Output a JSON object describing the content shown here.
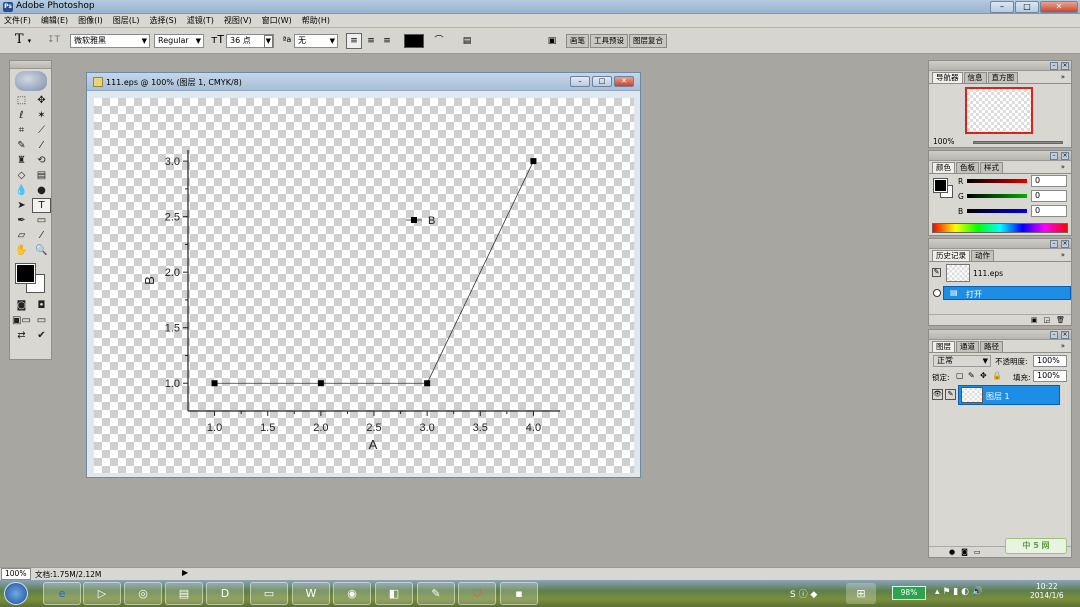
{
  "app": {
    "title": "Adobe Photoshop"
  },
  "menu": [
    "文件(F)",
    "编辑(E)",
    "图像(I)",
    "图层(L)",
    "选择(S)",
    "滤镜(T)",
    "视图(V)",
    "窗口(W)",
    "帮助(H)"
  ],
  "options": {
    "tool_glyph": "T",
    "font_family": "微软雅黑",
    "font_style": "Regular",
    "font_size": "36 点",
    "aa_label": "ªa",
    "aa_value": "无",
    "palette_well": [
      "画笔",
      "工具预设",
      "图层复合"
    ]
  },
  "document": {
    "title": "111.eps @ 100% (图层 1, CMYK/8)"
  },
  "chart_data": {
    "type": "line",
    "xlabel": "A",
    "ylabel": "B",
    "xlim": [
      0.75,
      4.25
    ],
    "ylim": [
      0.75,
      3.1
    ],
    "xticks": [
      "1.0",
      "1.5",
      "2.0",
      "2.5",
      "3.0",
      "3.5",
      "4.0"
    ],
    "yticks": [
      "1.0",
      "1.5",
      "2.0",
      "2.5",
      "3.0"
    ],
    "series": [
      {
        "name": "B",
        "x": [
          1.0,
          2.0,
          3.0,
          4.0
        ],
        "y": [
          1.0,
          1.0,
          1.0,
          3.0
        ]
      }
    ],
    "legend": "top-right",
    "grid": false
  },
  "navigator": {
    "tabs": [
      "导航器",
      "信息",
      "直方图"
    ],
    "zoom": "100%"
  },
  "color_panel": {
    "tabs": [
      "颜色",
      "色板",
      "样式"
    ],
    "channels": [
      {
        "label": "R",
        "value": "0",
        "color": "#d00000"
      },
      {
        "label": "G",
        "value": "0",
        "color": "#00a000"
      },
      {
        "label": "B",
        "value": "0",
        "color": "#0000c8"
      }
    ]
  },
  "history": {
    "tabs": [
      "历史记录",
      "动作"
    ],
    "snapshot": "111.eps",
    "steps": [
      "打开"
    ]
  },
  "layers": {
    "tabs": [
      "图层",
      "通道",
      "路径"
    ],
    "blend_mode": "正常",
    "opacity_label": "不透明度:",
    "opacity": "100%",
    "lock_label": "锁定:",
    "fill_label": "填充:",
    "fill": "100%",
    "items": [
      "图层 1"
    ]
  },
  "status": {
    "zoom": "100%",
    "doc_info": "文档:1.75M/2.12M"
  },
  "taskbar": {
    "battery": "98%",
    "time": "10:22",
    "date": "2014/1/6",
    "watermark": "中 5 网"
  },
  "colors": {
    "selection": "#1c8ee6",
    "accent": "#2a4d8f"
  }
}
